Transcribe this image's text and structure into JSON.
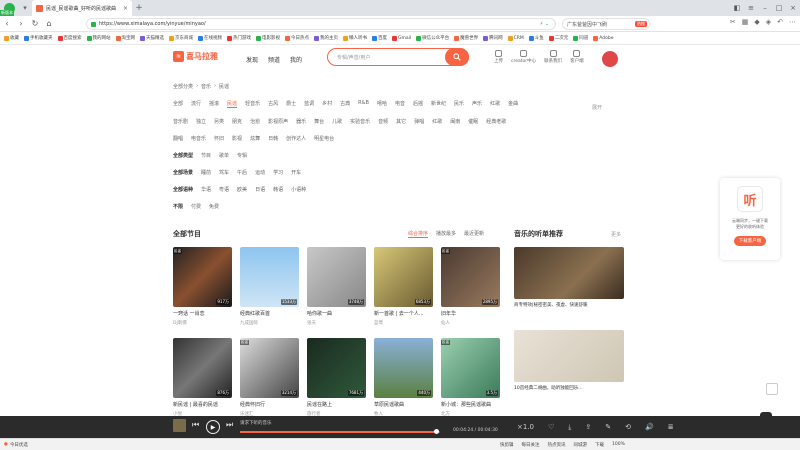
{
  "browser": {
    "logo_badge": "新版本",
    "tab_title": "民谣_民谣歌曲_好听的民谣歌曲",
    "url": "https://www.ximalaya.com/yinyue/minyao/",
    "search_query": "广东爸爸因中飞刷",
    "search_badge": "热搜",
    "bookmarks": [
      "收藏",
      "手机收藏夹",
      "百度搜索",
      "我的网站",
      "淘宝网",
      "天猫精选",
      "京东商城",
      "在线视频",
      "热门游戏",
      "电影影视",
      "今日热点",
      "我的主页",
      "懒人听书",
      "百度",
      "Gmail",
      "微信公众平台",
      "魔兽世界",
      "腾讯网",
      "CRM",
      "斗鱼",
      "二次元",
      "同道",
      "Adobe"
    ]
  },
  "site": {
    "logo_text": "喜马拉雅",
    "nav": [
      "发现",
      "频道",
      "我的"
    ],
    "search_placeholder": "专辑/声音/用户",
    "header_icons": [
      "上传",
      "creator中心",
      "联系我们",
      "客户端"
    ]
  },
  "breadcrumb": [
    "全部分类",
    "音乐",
    "民谣"
  ],
  "filters": {
    "row1": [
      "全部",
      "流行",
      "摇滚",
      "民谣",
      "轻音乐",
      "古风",
      "爵士",
      "蓝调",
      "乡村",
      "古典",
      "R&B",
      "嘻哈",
      "电音",
      "后摇",
      "新世纪",
      "民乐",
      "声乐",
      "红歌",
      "金曲"
    ],
    "active": "民谣",
    "more": "展开",
    "row2": [
      "音乐剧",
      "独立",
      "另类",
      "朋克",
      "治愈",
      "影视原声",
      "器乐",
      "舞台",
      "儿歌",
      "实验音乐",
      "音频",
      "其它",
      "弹唱",
      "红歌",
      "闽南",
      "催眠",
      "经典老歌"
    ],
    "row3": [
      "翻唱",
      "电音乐",
      "怀旧",
      "影视",
      "炫舞",
      "日韩",
      "创作达人",
      "明星电台"
    ],
    "row4": {
      "label": "全部类型",
      "items": [
        "节目",
        "歌单",
        "专辑"
      ]
    },
    "row5": {
      "label": "全部场景",
      "items": [
        "睡前",
        "驾车",
        "午后",
        "运动",
        "学习",
        "开车"
      ]
    },
    "row6": {
      "label": "全部语种",
      "items": [
        "华语",
        "粤语",
        "欧美",
        "日语",
        "韩语",
        "小语种"
      ]
    },
    "row7": {
      "label": "不限",
      "items": [
        "付费",
        "免费"
      ]
    }
  },
  "content": {
    "section_title": "全部节目",
    "sort_tabs": [
      "综合排序",
      "播放最多",
      "最近更新"
    ],
    "cards": [
      {
        "title": "一窍话 一肖恋",
        "author": "DJ刺猬",
        "plays": "917万",
        "tag": "民谣"
      },
      {
        "title": "经典红歌百首",
        "author": "九成国际",
        "plays": "1533万",
        "tag": ""
      },
      {
        "title": "哈你歌一曲",
        "author": "张天",
        "plays": "3748万",
        "tag": ""
      },
      {
        "title": "新一首歌 | 去一个人...",
        "author": "蓝莺",
        "plays": "6853万",
        "tag": ""
      },
      {
        "title": "旧年华",
        "author": "仙人",
        "plays": "2895万",
        "tag": "民谣"
      },
      {
        "title": "新民谣 | 最喜的民谣",
        "author": "小悦",
        "plays": "876万",
        "tag": ""
      },
      {
        "title": "经典怀旧行",
        "author": "乐迷汇",
        "plays": "3214万",
        "tag": "民谣"
      },
      {
        "title": "民谣在路上",
        "author": "旅行者",
        "plays": "7681万",
        "tag": ""
      },
      {
        "title": "草原民谣歌曲",
        "author": "牧人",
        "plays": "440万",
        "tag": ""
      },
      {
        "title": "新小城：那些民谣歌曲",
        "author": "北方",
        "plays": "3.5万",
        "tag": "民谣"
      }
    ],
    "side_title": "音乐的听单推荐",
    "side_more": "更多",
    "recs": [
      {
        "title": "商专特效|秘密密美、夜虚、快速舒暖"
      },
      {
        "title": "10首经典二胡曲，助听独能回乐..."
      }
    ]
  },
  "promo": {
    "icon": "听",
    "text_line1": "云端同步，一键下载",
    "text_line2": "更好的收听体验",
    "button": "下载客户端"
  },
  "player": {
    "title": "请求下听的音乐",
    "time": "00:04:24 / 00:04:30",
    "progress": 0.98
  },
  "statusbar": {
    "left": "今日优选",
    "right": [
      "快剪辑",
      "每日关注",
      "热点资讯",
      "同城游",
      "下载",
      "100%"
    ]
  }
}
